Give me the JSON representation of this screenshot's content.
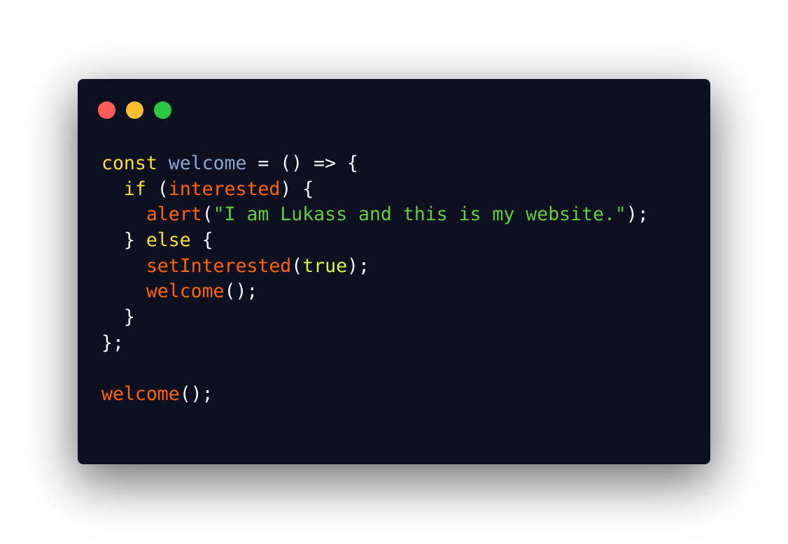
{
  "colors": {
    "background": "#0d1021",
    "close": "#ff5f57",
    "minimize": "#febc2e",
    "maximize": "#28c840",
    "keyword": "#fbde2d",
    "identifier": "#8da6ce",
    "function": "#ff6400",
    "string": "#61ce3c",
    "boolean": "#d8fa3c",
    "punctuation": "#f8f8f8"
  },
  "window_controls": [
    {
      "name": "close",
      "color": "#ff5f57"
    },
    {
      "name": "minimize",
      "color": "#febc2e"
    },
    {
      "name": "maximize",
      "color": "#28c840"
    }
  ],
  "code_lines": [
    [
      {
        "text": "const",
        "type": "keyword"
      },
      {
        "text": " ",
        "type": "punctuation"
      },
      {
        "text": "welcome",
        "type": "identifier"
      },
      {
        "text": " = () => {",
        "type": "punctuation"
      }
    ],
    [
      {
        "text": "  ",
        "type": "punctuation"
      },
      {
        "text": "if",
        "type": "keyword"
      },
      {
        "text": " (",
        "type": "punctuation"
      },
      {
        "text": "interested",
        "type": "function"
      },
      {
        "text": ") {",
        "type": "punctuation"
      }
    ],
    [
      {
        "text": "    ",
        "type": "punctuation"
      },
      {
        "text": "alert",
        "type": "function"
      },
      {
        "text": "(",
        "type": "punctuation"
      },
      {
        "text": "\"I am Lukass and this is my website.\"",
        "type": "string"
      },
      {
        "text": ");",
        "type": "punctuation"
      }
    ],
    [
      {
        "text": "  } ",
        "type": "punctuation"
      },
      {
        "text": "else",
        "type": "keyword"
      },
      {
        "text": " {",
        "type": "punctuation"
      }
    ],
    [
      {
        "text": "    ",
        "type": "punctuation"
      },
      {
        "text": "setInterested",
        "type": "function"
      },
      {
        "text": "(",
        "type": "punctuation"
      },
      {
        "text": "true",
        "type": "boolean"
      },
      {
        "text": ");",
        "type": "punctuation"
      }
    ],
    [
      {
        "text": "    ",
        "type": "punctuation"
      },
      {
        "text": "welcome",
        "type": "function"
      },
      {
        "text": "();",
        "type": "punctuation"
      }
    ],
    [
      {
        "text": "  }",
        "type": "punctuation"
      }
    ],
    [
      {
        "text": "};",
        "type": "punctuation"
      }
    ],
    [],
    [
      {
        "text": "welcome",
        "type": "function"
      },
      {
        "text": "();",
        "type": "punctuation"
      }
    ]
  ]
}
